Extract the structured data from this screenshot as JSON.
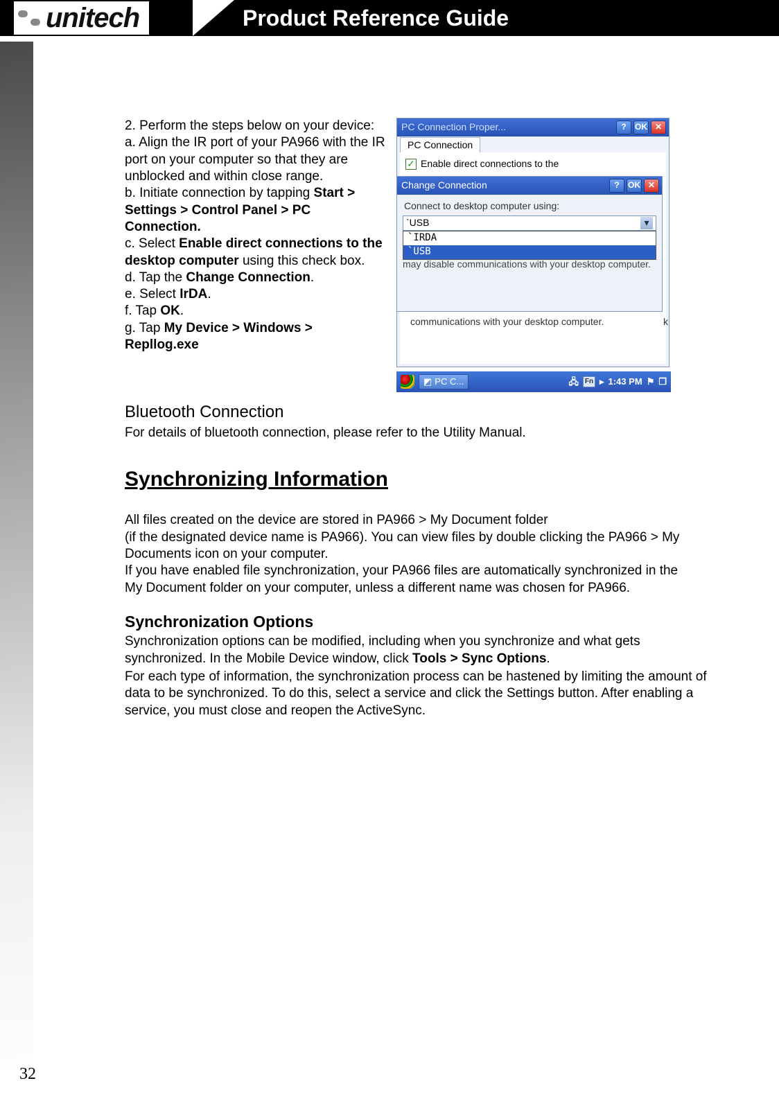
{
  "header": {
    "brand": "unitech",
    "title": "Product Reference Guide"
  },
  "page_number": "32",
  "instructions": {
    "intro": "2. Perform the steps below on your device:",
    "a": "a. Align the IR port of your PA966 with the IR port on your computer so that they are unblocked and within close range.",
    "b_pre": "b. Initiate connection by tapping ",
    "b_bold": "Start > Settings > Control Panel > PC Connection.",
    "c_pre": "c. Select ",
    "c_bold": "Enable direct connections to the desktop computer",
    "c_post": " using this check box.",
    "d_pre": "d. Tap the ",
    "d_bold": "Change Connection",
    "d_post": ".",
    "e_pre": "e. Select ",
    "e_bold": "IrDA",
    "e_post": ".",
    "f_pre": "f. Tap ",
    "f_bold": "OK",
    "f_post": ".",
    "g_pre": "g. Tap ",
    "g_bold": "My Device > Windows > Repllog.exe"
  },
  "screenshot": {
    "win1_title": "PC Connection Proper...",
    "btn_help": "?",
    "btn_ok": "OK",
    "btn_close": "✕",
    "tab": "PC Connection",
    "checkbox_label": "Enable direct connections to the",
    "win2_title": "Change Connection",
    "win2_label": "Connect to desktop computer using:",
    "combo_value": "`USB",
    "options": {
      "irda": "`IRDA",
      "usb": "`USB"
    },
    "win2_note": "may disable communications with your desktop computer.",
    "under_note": "communications with your desktop computer.",
    "stray_k": "k",
    "task_app": "PC C...",
    "task_fn": "Fn",
    "task_time": "1:43 PM"
  },
  "bluetooth": {
    "heading": "Bluetooth Connection",
    "text": "For details of bluetooth connection, please refer to the Utility Manual."
  },
  "sync": {
    "heading": "Synchronizing Information",
    "p1": "All files created on the device are stored in PA966 > My Document folder",
    "p2": "(if the designated device name is PA966). You can view files by double clicking the PA966 > My Documents icon on your computer.",
    "p3": "If you have enabled file synchronization, your PA966 files are automatically synchronized in the My Document folder on your computer, unless a different name was chosen for PA966."
  },
  "sync_opts": {
    "heading": "Synchronization Options",
    "p1_pre": "Synchronization options can be modified, including when you synchronize and what gets synchronized. In the Mobile Device window, click ",
    "p1_bold": "Tools > Sync Options",
    "p1_post": ".",
    "p2": "For each type of information, the synchronization process can be hastened by limiting the amount of data to be synchronized. To do this, select a service and click the Settings button. After enabling a service, you must close and reopen the ActiveSync."
  }
}
